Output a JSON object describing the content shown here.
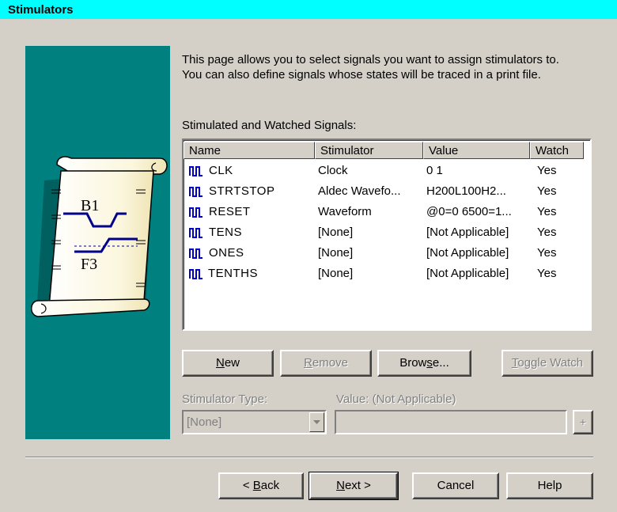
{
  "window": {
    "title": "Stimulators"
  },
  "intro": {
    "line1": "This page allows you to select signals you want to assign stimulators to.",
    "line2": "You can also define signals whose states will be traced in a print file."
  },
  "illustration": {
    "top_label": "B1",
    "bottom_label": "F3"
  },
  "signals": {
    "caption": "Stimulated and Watched Signals:",
    "columns": {
      "name": "Name",
      "stimulator": "Stimulator",
      "value": "Value",
      "watch": "Watch"
    },
    "rows": [
      {
        "name": "CLK",
        "stimulator": "Clock",
        "value": "0 1",
        "watch": "Yes"
      },
      {
        "name": "STRTSTOP",
        "stimulator": "Aldec Wavefo...",
        "value": "H200L100H2...",
        "watch": "Yes"
      },
      {
        "name": "RESET",
        "stimulator": "Waveform",
        "value": "@0=0 6500=1...",
        "watch": "Yes"
      },
      {
        "name": "TENS",
        "stimulator": "[None]",
        "value": "[Not Applicable]",
        "watch": "Yes"
      },
      {
        "name": "ONES",
        "stimulator": "[None]",
        "value": "[Not Applicable]",
        "watch": "Yes"
      },
      {
        "name": "TENTHS",
        "stimulator": "[None]",
        "value": "[Not Applicable]",
        "watch": "Yes"
      }
    ]
  },
  "actions": {
    "new": {
      "hot": "N",
      "rest": "ew"
    },
    "remove": {
      "hot": "R",
      "rest": "emove"
    },
    "browse": {
      "pre": "Brow",
      "hot": "s",
      "rest": "e..."
    },
    "toggle": {
      "hot": "T",
      "rest": "oggle Watch"
    }
  },
  "stimulator_type": {
    "label": "Stimulator Type:",
    "selected": "[None]"
  },
  "value_field": {
    "label": "Value: (Not Applicable)",
    "value": "",
    "browse_label": "+"
  },
  "footer": {
    "back": {
      "pre": "< ",
      "hot": "B",
      "rest": "ack"
    },
    "next": {
      "hot": "N",
      "rest": "ext >"
    },
    "cancel": "Cancel",
    "help": "Help"
  },
  "colors": {
    "title_bg": "#00ffff",
    "panel_bg": "#00817f",
    "dialog_bg": "#d4d0c8",
    "signal_icon": "#0000cc"
  }
}
